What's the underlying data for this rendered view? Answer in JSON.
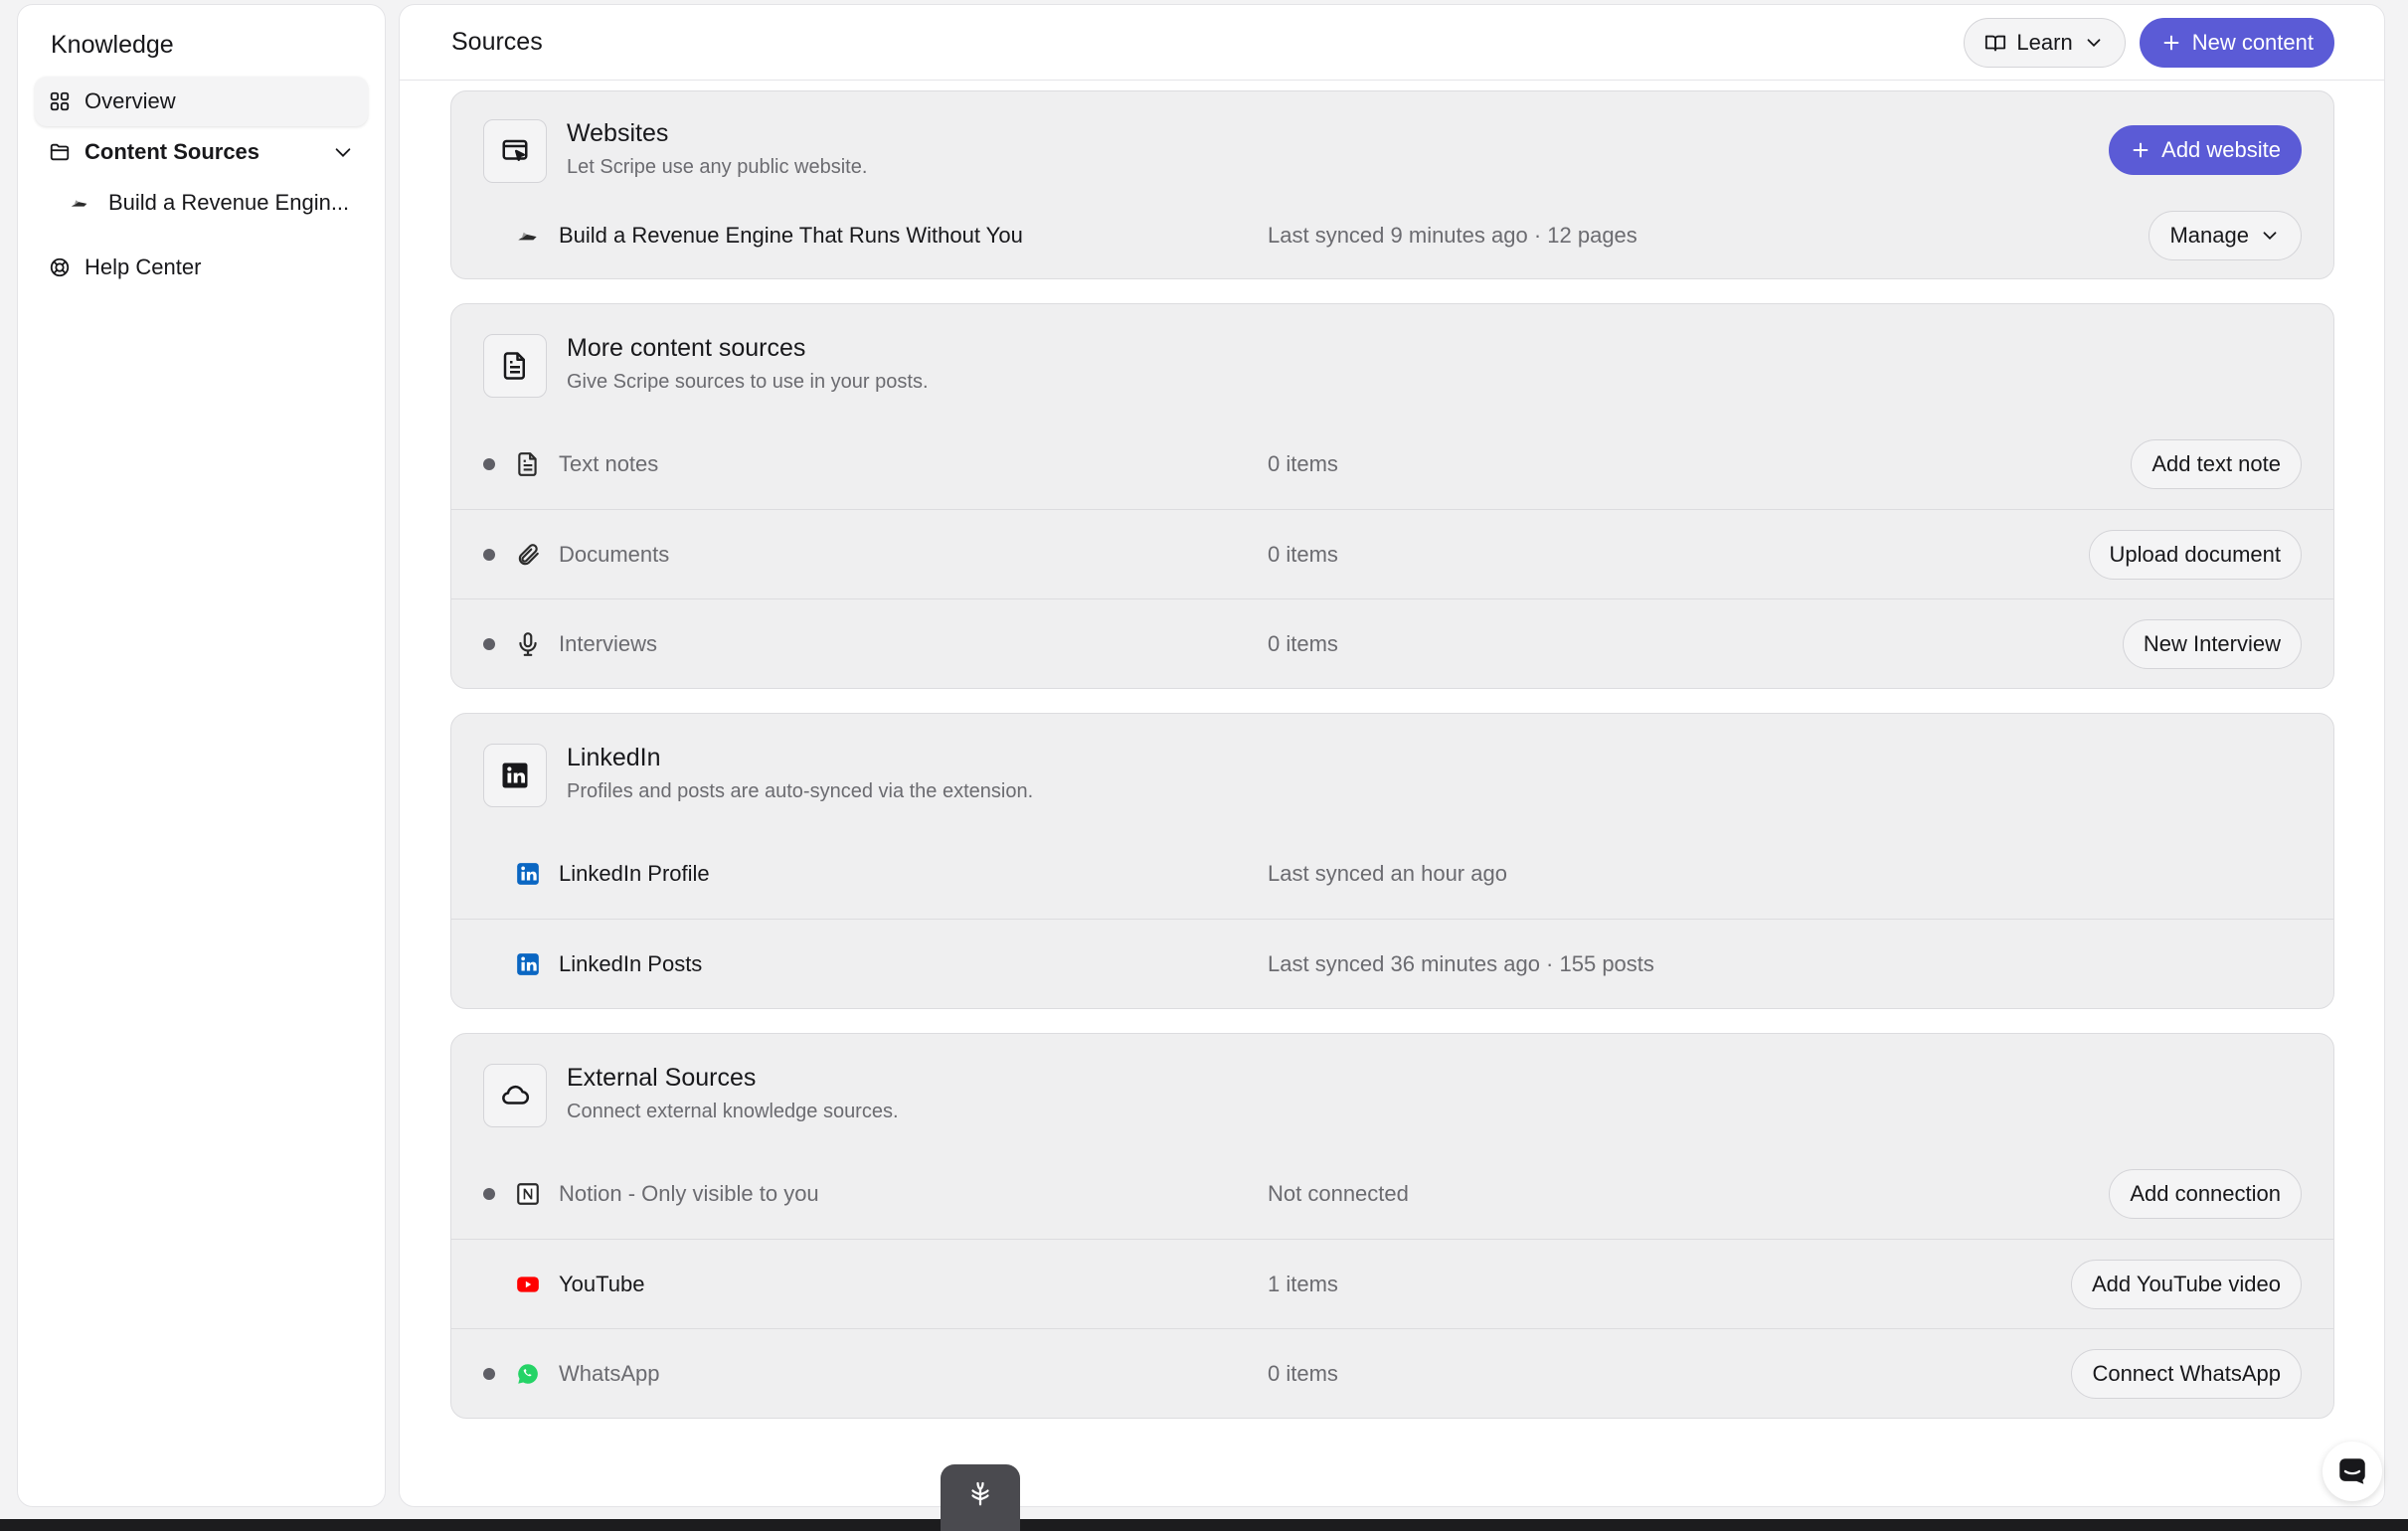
{
  "sidebar": {
    "title": "Knowledge",
    "items": [
      {
        "label": "Overview",
        "icon": "grid-icon"
      },
      {
        "label": "Content Sources",
        "icon": "folder-icon"
      },
      {
        "label": "Build a Revenue Engin...",
        "icon": "site-favicon-icon"
      },
      {
        "label": "Help Center",
        "icon": "lifebuoy-icon"
      }
    ]
  },
  "header": {
    "title": "Sources",
    "learn_label": "Learn",
    "new_content_label": "New content"
  },
  "websites": {
    "title": "Websites",
    "description": "Let Scripe use any public website.",
    "add_label": "Add website",
    "rows": [
      {
        "name": "Build a Revenue Engine That Runs Without You",
        "meta": "Last synced 9 minutes ago · 12 pages",
        "action": "Manage"
      }
    ]
  },
  "more_sources": {
    "title": "More content sources",
    "description": "Give Scripe sources to use in your posts.",
    "rows": [
      {
        "name": "Text notes",
        "meta": "0 items",
        "action": "Add text note"
      },
      {
        "name": "Documents",
        "meta": "0 items",
        "action": "Upload document"
      },
      {
        "name": "Interviews",
        "meta": "0 items",
        "action": "New Interview"
      }
    ]
  },
  "linkedin": {
    "title": "LinkedIn",
    "description": "Profiles and posts are auto-synced via the extension.",
    "rows": [
      {
        "name": "LinkedIn Profile",
        "meta": "Last synced an hour ago"
      },
      {
        "name": "LinkedIn Posts",
        "meta": "Last synced 36 minutes ago · 155 posts"
      }
    ]
  },
  "external": {
    "title": "External Sources",
    "description": "Connect external knowledge sources.",
    "rows": [
      {
        "name": "Notion - Only visible to you",
        "meta": "Not connected",
        "action": "Add connection"
      },
      {
        "name": "YouTube",
        "meta": "1 items",
        "action": "Add YouTube video"
      },
      {
        "name": "WhatsApp",
        "meta": "0 items",
        "action": "Connect WhatsApp"
      }
    ]
  },
  "colors": {
    "primary": "#5b5bd6",
    "linkedin": "#0a66c2",
    "youtube": "#ff0000",
    "whatsapp": "#25d366"
  }
}
